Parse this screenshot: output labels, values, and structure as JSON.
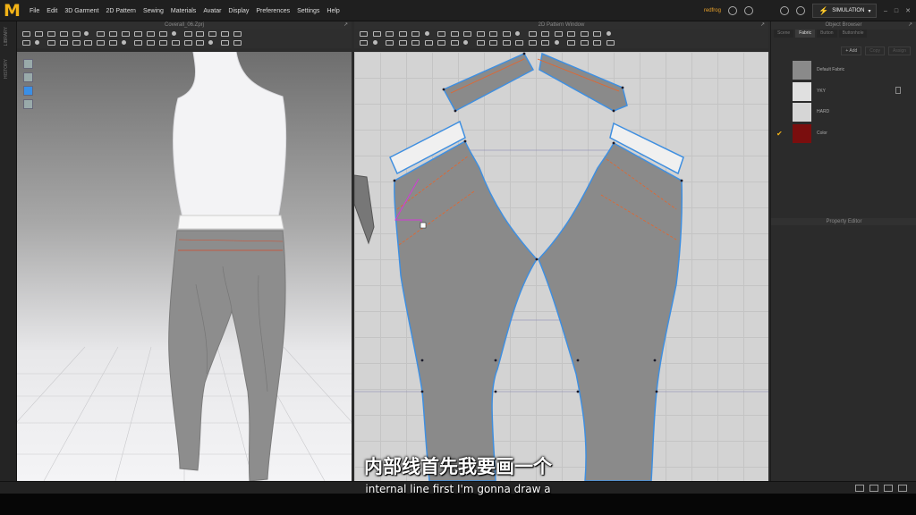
{
  "app": {
    "logo": "M"
  },
  "menu": [
    "File",
    "Edit",
    "3D Garment",
    "2D Pattern",
    "Sewing",
    "Materials",
    "Avatar",
    "Display",
    "Preferences",
    "Settings",
    "Help"
  ],
  "topbar": {
    "user_label": "redfrog",
    "mode": "SIMULATION"
  },
  "left_strip": {
    "tabs": [
      "LIBRARY",
      "HISTORY"
    ]
  },
  "panel_3d": {
    "title": "Coverall_06.Zprj"
  },
  "panel_2d": {
    "title": "2D Pattern Window"
  },
  "object_browser": {
    "title": "Object Browser",
    "tabs": [
      {
        "label": "Scene",
        "active": false
      },
      {
        "label": "Fabric",
        "active": true
      },
      {
        "label": "Button",
        "active": false
      },
      {
        "label": "Buttonhole",
        "active": false
      }
    ],
    "buttons": [
      {
        "label": "+ Add",
        "enabled": true
      },
      {
        "label": "Copy",
        "enabled": false
      },
      {
        "label": "Assign",
        "enabled": false
      }
    ],
    "fabrics": [
      {
        "label": "Default Fabric",
        "color": "#8a8a8a",
        "checked": false
      },
      {
        "label": "YKY",
        "color": "#e0e0e0",
        "checked": false
      },
      {
        "label": "HARD",
        "color": "#d6d6d6",
        "checked": false
      },
      {
        "label": "Color",
        "color": "#7a0e0e",
        "checked": true
      }
    ]
  },
  "property_editor": {
    "title": "Property Editor"
  },
  "subtitles": {
    "zh": "内部线首先我要画一个",
    "en": "internal line first I'm gonna draw a"
  },
  "colors": {
    "accent": "#f2b317",
    "pattern_fill": "#8a8a8a",
    "pattern_outline": "#3f8fe0",
    "internal_line": "#e8642a"
  }
}
